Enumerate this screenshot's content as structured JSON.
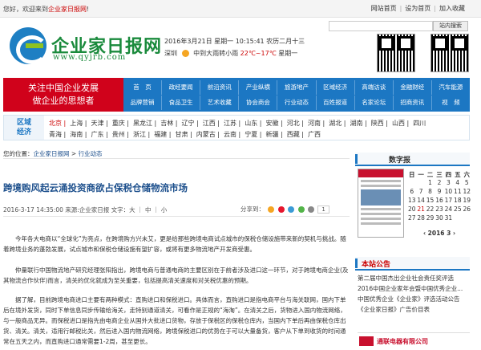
{
  "topbar": {
    "welcome_prefix": "您好，欢迎来到",
    "welcome_site": "企业家日报网",
    "welcome_suffix": "!",
    "links": [
      "网站首页",
      "设为首页",
      "加入收藏"
    ]
  },
  "search": {
    "placeholder": "",
    "button": "站内搜索"
  },
  "logo": {
    "name": "企业家日报网",
    "url": "www.qyjrb.com"
  },
  "date": {
    "line": "2016年3月21日  星期一  10:15:41  农历二月十三",
    "city": "深圳",
    "weather": "中到大雨转小雨",
    "temp": "22℃~17℃",
    "day": "星期一"
  },
  "qr": {
    "left_caption": "",
    "right_caption": ""
  },
  "slogan": [
    "关注中国企业发展",
    "做企业的思想者"
  ],
  "nav": {
    "row1": [
      "首　页",
      "政经要闻",
      "前沿资讯",
      "产业纵横",
      "旅游地产",
      "区域经济",
      "高端访谈",
      "金融财经",
      "汽车能源"
    ],
    "row2": [
      "品牌营销",
      "食品卫生",
      "艺术收藏",
      "协会商会",
      "行业动态",
      "百姓报道",
      "名家论坛",
      "招商资讯",
      "视　频"
    ]
  },
  "region": {
    "label": [
      "区域",
      "经济"
    ],
    "row1": [
      "北京",
      "上海",
      "天津",
      "重庆",
      "黑龙江",
      "吉林",
      "辽宁",
      "江西",
      "江苏",
      "山东",
      "安徽",
      "河北",
      "河南",
      "湖北",
      "湖南",
      "陕西",
      "山西",
      "四川"
    ],
    "row2": [
      "青海",
      "海南",
      "广东",
      "贵州",
      "浙江",
      "福建",
      "甘肃",
      "内蒙古",
      "云南",
      "宁夏",
      "新疆",
      "西藏",
      "广西"
    ]
  },
  "breadcrumb": {
    "prefix": "您的位置：",
    "home": "企业家日报网",
    "sep": " > ",
    "section": "行业动态"
  },
  "article": {
    "title": "跨境购风起云涌投资商欲占保税仓储物流市场",
    "meta": "2016-3-17 14:35:00  来源:企业家日报  文字：大 ｜ 中 ｜ 小",
    "share_label": "分享到：",
    "share_count": "1",
    "paragraphs": [
      "今年各大电商以“全球化”为亮点，在跨境购方兴未艾，更是给那些跨境电商试点城市的保税仓储设施带来新的契机与挑战。随着跨境业务的蓬勃发展，试点城市和保税仓储设施有望扩容，或将有更多物流地产开发商受惠。",
      "仲量联行中国物流地产研究经理张阳指出，跨境电商与普通电商的主要区别在于前者涉及进口这一环节，对于跨境电商企业(及其物流合作伙伴)而言，清关的优化就成为至关重要，包括提高清关速度和对关税优惠的预期。",
      "据了解，目前跨境电商进口主要有两种模式：直购进口和保税进口。具体而言，直购进口是指电商平台与海关联网，国内下单后在境外发货，同时下单信息同步传输给海关，走特别通道清关，可看作是正规的“海淘”。在清关之后，货物进入国内物流网络，与一般商品无异。而保税进口是指先由电商企业从国外大批进口货物，存放于保税区的保税仓库内，当国内下单后再由保税仓库出货、清关。清关，适用行邮税比关，然后进入国内物流网络，跨境保税进口的优势在于可以大量备货，客户从下单到收货的时间通常在五天之内，而直购进口通常需要1-2周，甚至更长。"
    ]
  },
  "sidebar": {
    "digital_title": "数字报",
    "calendar": {
      "weekdays": [
        "日",
        "一",
        "二",
        "三",
        "四",
        "五",
        "六"
      ],
      "weeks": [
        [
          "",
          "",
          "1",
          "2",
          "3",
          "4",
          "5"
        ],
        [
          "6",
          "7",
          "8",
          "9",
          "10",
          "11",
          "12"
        ],
        [
          "13",
          "14",
          "15",
          "16",
          "17",
          "18",
          "19"
        ],
        [
          "20",
          "21",
          "22",
          "23",
          "24",
          "25",
          "26"
        ],
        [
          "27",
          "28",
          "29",
          "30",
          "31",
          "",
          ""
        ]
      ],
      "today": "21",
      "control": "‹ 2016 3 ›"
    },
    "notice_title": "本站公告",
    "notices": [
      "第二届中国杰出企业社会责任奖评选",
      "2016中国企业家年会暨中国优秀企业...",
      "中国优秀企业《企业家》评选活动公告",
      "《企业家日报》广告价目表"
    ],
    "ad_text": "通联电器有限公司"
  },
  "colors": {
    "brand_blue": "#1c77c3",
    "brand_red": "#d0021b",
    "logo_green": "#1a8a3c"
  }
}
